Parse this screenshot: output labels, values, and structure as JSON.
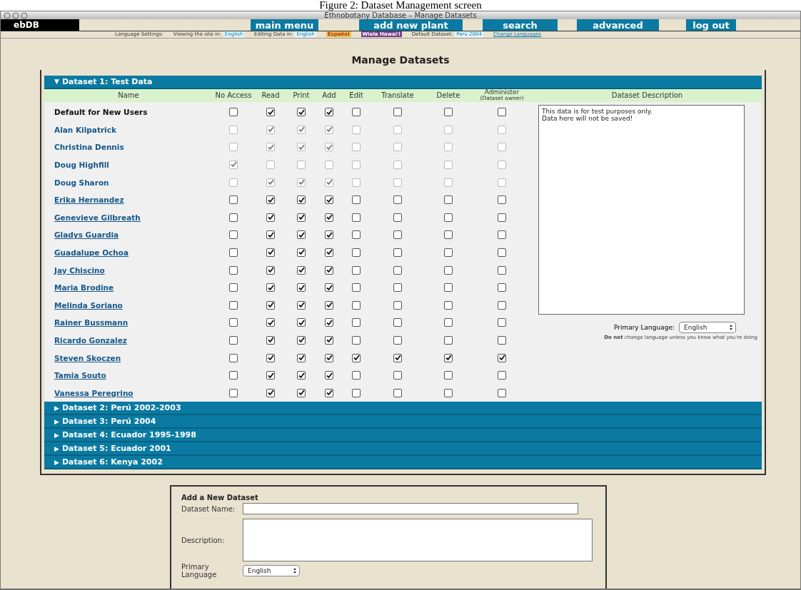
{
  "caption": "Figure 2: Dataset Management screen",
  "window": {
    "title": "Ethnobotany Database – Manage Datasets"
  },
  "logo": "ebDB",
  "nav": [
    "main menu",
    "add new plant",
    "search",
    "advanced",
    "log out"
  ],
  "language_bar": [
    {
      "kind": "label",
      "text": "Language Settings:"
    },
    {
      "kind": "setting",
      "label": "Viewing the site in:",
      "value": "English"
    },
    {
      "kind": "setting",
      "label": "Editing Data in:",
      "value": "English"
    },
    {
      "kind": "tag",
      "text": "Español",
      "color": "#f0c040"
    },
    {
      "kind": "tag",
      "text": "Wiela Hawai'i",
      "color": "#7a3e8c"
    },
    {
      "kind": "setting",
      "label": "Default Dataset:",
      "value": "Perú 2004"
    },
    {
      "kind": "link",
      "text": "Change Languages"
    }
  ],
  "heading": "Manage Datasets",
  "datasets": [
    {
      "title": "Dataset 1: Test Data",
      "expanded": true
    },
    {
      "title": "Dataset 2: Perú 2002-2003",
      "expanded": false
    },
    {
      "title": "Dataset 3: Perú 2004",
      "expanded": false
    },
    {
      "title": "Dataset 4: Ecuador 1995-1998",
      "expanded": false
    },
    {
      "title": "Dataset 5: Ecuador 2001",
      "expanded": false
    },
    {
      "title": "Dataset 6: Kenya 2002",
      "expanded": false
    }
  ],
  "expand_marks": {
    "open": "▼",
    "closed": "▶"
  },
  "columns": {
    "name": "Name",
    "permissions": [
      "No Access",
      "Read",
      "Print",
      "Add",
      "Edit",
      "Translate",
      "Delete",
      "Administer"
    ],
    "admin_note": "(Dataset owner)",
    "description": "Dataset Description"
  },
  "users": [
    {
      "name": "Default for New Users",
      "linked": false,
      "disabled": false,
      "permissions": [
        false,
        true,
        true,
        true,
        false,
        false,
        false,
        false
      ]
    },
    {
      "name": "Alan Kilpatrick",
      "linked": false,
      "disabled": true,
      "permissions": [
        false,
        true,
        true,
        true,
        false,
        false,
        false,
        false
      ]
    },
    {
      "name": "Christina Dennis",
      "linked": false,
      "disabled": true,
      "permissions": [
        false,
        true,
        true,
        true,
        false,
        false,
        false,
        false
      ]
    },
    {
      "name": "Doug Highfill",
      "linked": false,
      "disabled": true,
      "permissions": [
        true,
        false,
        false,
        false,
        false,
        false,
        false,
        false
      ]
    },
    {
      "name": "Doug Sharon",
      "linked": false,
      "disabled": true,
      "permissions": [
        false,
        true,
        true,
        true,
        false,
        false,
        false,
        false
      ]
    },
    {
      "name": "Erika Hernandez",
      "linked": true,
      "disabled": false,
      "permissions": [
        false,
        true,
        true,
        true,
        false,
        false,
        false,
        false
      ]
    },
    {
      "name": "Genevieve Gilbreath",
      "linked": true,
      "disabled": false,
      "permissions": [
        false,
        true,
        true,
        true,
        false,
        false,
        false,
        false
      ]
    },
    {
      "name": "Gladys Guardia",
      "linked": true,
      "disabled": false,
      "permissions": [
        false,
        true,
        true,
        true,
        false,
        false,
        false,
        false
      ]
    },
    {
      "name": "Guadalupe Ochoa",
      "linked": true,
      "disabled": false,
      "permissions": [
        false,
        true,
        true,
        true,
        false,
        false,
        false,
        false
      ]
    },
    {
      "name": "Jay Chiscino",
      "linked": true,
      "disabled": false,
      "permissions": [
        false,
        true,
        true,
        true,
        false,
        false,
        false,
        false
      ]
    },
    {
      "name": "Maria Brodine",
      "linked": true,
      "disabled": false,
      "permissions": [
        false,
        true,
        true,
        true,
        false,
        false,
        false,
        false
      ]
    },
    {
      "name": "Melinda Soriano",
      "linked": true,
      "disabled": false,
      "permissions": [
        false,
        true,
        true,
        true,
        false,
        false,
        false,
        false
      ]
    },
    {
      "name": "Rainer Bussmann",
      "linked": true,
      "disabled": false,
      "permissions": [
        false,
        true,
        true,
        true,
        false,
        false,
        false,
        false
      ]
    },
    {
      "name": "Ricardo Gonzalez",
      "linked": true,
      "disabled": false,
      "permissions": [
        false,
        true,
        true,
        true,
        false,
        false,
        false,
        false
      ]
    },
    {
      "name": "Steven Skoczen",
      "linked": true,
      "disabled": false,
      "permissions": [
        false,
        true,
        true,
        true,
        true,
        true,
        true,
        true
      ]
    },
    {
      "name": "Tamia Souto",
      "linked": true,
      "disabled": false,
      "permissions": [
        false,
        true,
        true,
        true,
        false,
        false,
        false,
        false
      ]
    },
    {
      "name": "Vanessa Peregrino",
      "linked": true,
      "disabled": false,
      "permissions": [
        false,
        true,
        true,
        true,
        false,
        false,
        false,
        false
      ]
    }
  ],
  "description": {
    "value": "This data is for test purposes only.\nData here will not be saved!",
    "language_label": "Primary Language:",
    "language": "English",
    "warning": "**Do not** change language unless you know what you're doing"
  },
  "add_form": {
    "title": "Add a New Dataset",
    "name_label": "Dataset Name:",
    "description_label": "Description:",
    "language_label": "Primary Language",
    "language": "English"
  }
}
